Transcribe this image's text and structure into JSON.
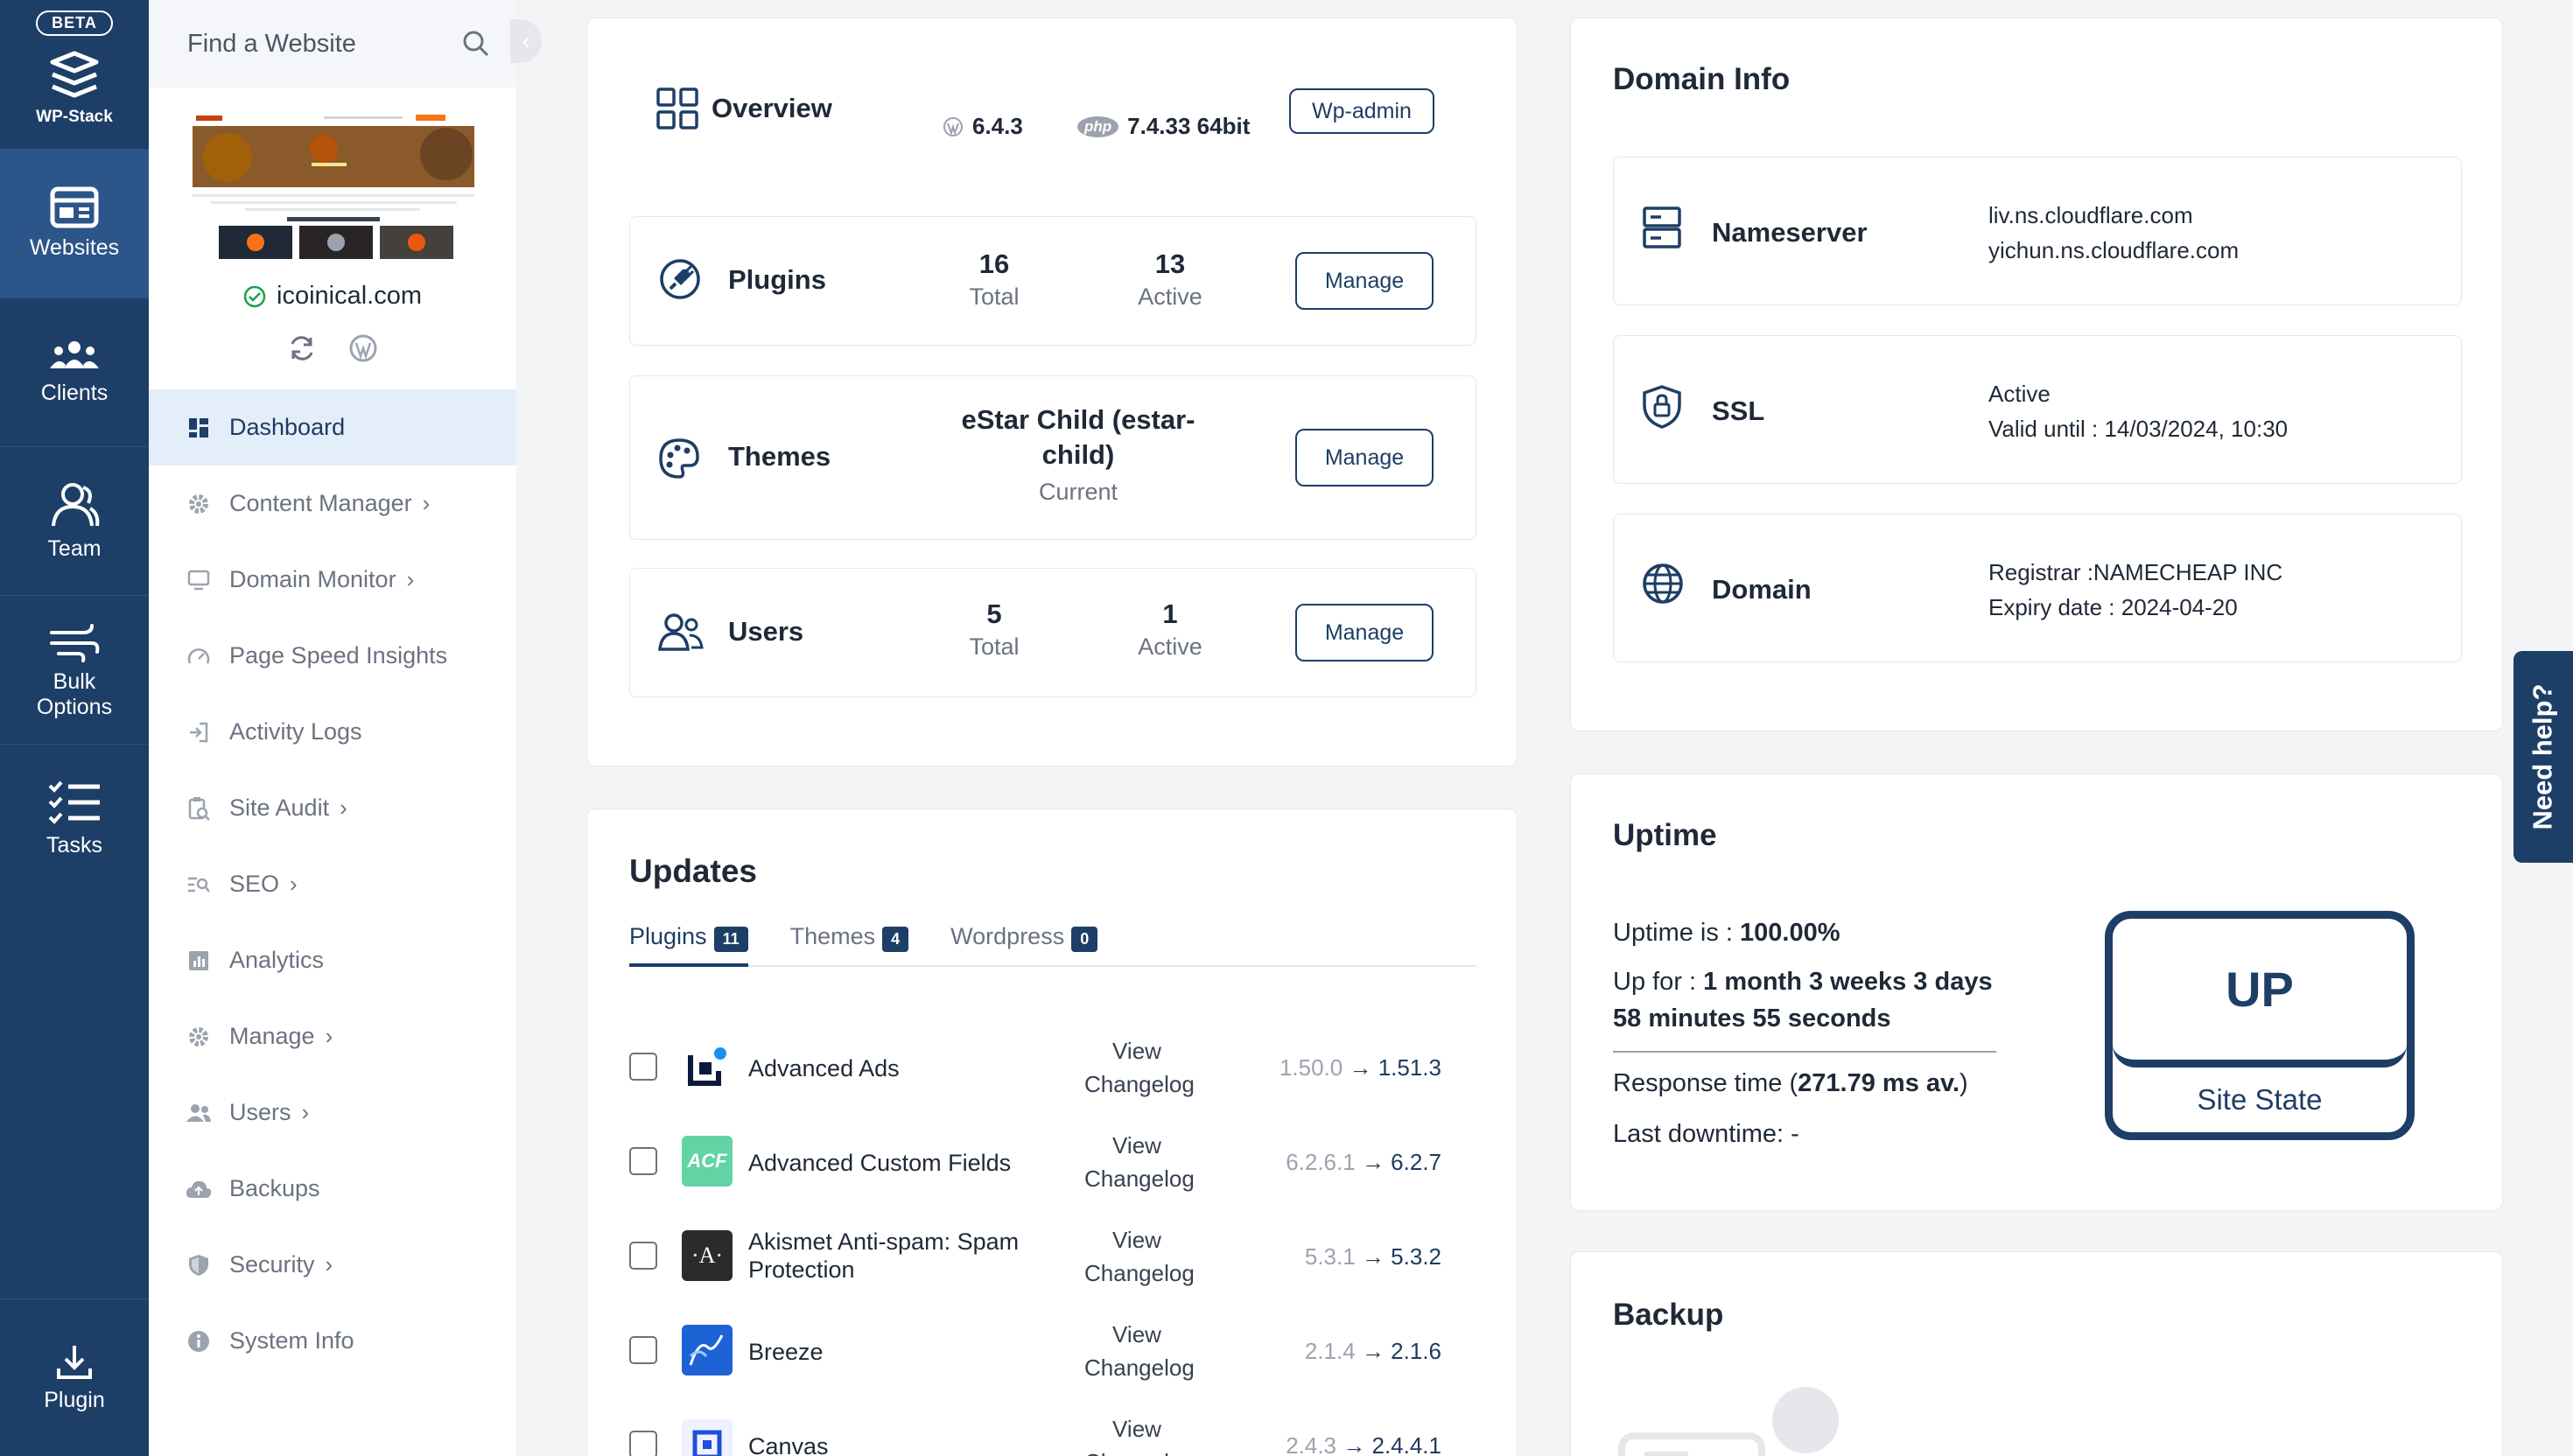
{
  "rail": {
    "beta": "BETA",
    "brand": "WP-Stack",
    "items": [
      {
        "label": "Websites",
        "icon": "websites-icon"
      },
      {
        "label": "Clients",
        "icon": "clients-icon"
      },
      {
        "label": "Team",
        "icon": "team-icon"
      },
      {
        "label": "Bulk Options",
        "icon": "bulk-options-icon"
      },
      {
        "label": "Tasks",
        "icon": "tasks-icon"
      }
    ],
    "plugin": "Plugin"
  },
  "sidebar": {
    "search_placeholder": "Find a Website",
    "site_name": "icoinical.com",
    "menu": [
      {
        "label": "Dashboard"
      },
      {
        "label": "Content Manager"
      },
      {
        "label": "Domain Monitor"
      },
      {
        "label": "Page Speed Insights"
      },
      {
        "label": "Activity Logs"
      },
      {
        "label": "Site Audit"
      },
      {
        "label": "SEO"
      },
      {
        "label": "Analytics"
      },
      {
        "label": "Manage"
      },
      {
        "label": "Users"
      },
      {
        "label": "Backups"
      },
      {
        "label": "Security"
      },
      {
        "label": "System Info"
      }
    ]
  },
  "overview": {
    "title": "Overview",
    "wp_version": "6.4.3",
    "php_badge": "php",
    "php_version": "7.4.33 64bit",
    "wp_admin": "Wp-admin",
    "plugins": {
      "label": "Plugins",
      "total": "16",
      "total_label": "Total",
      "active": "13",
      "active_label": "Active",
      "button": "Manage"
    },
    "themes": {
      "label": "Themes",
      "current": "eStar Child (estar-child)",
      "current_label": "Current",
      "button": "Manage"
    },
    "users": {
      "label": "Users",
      "total": "5",
      "total_label": "Total",
      "active": "1",
      "active_label": "Active",
      "button": "Manage"
    }
  },
  "updates": {
    "title": "Updates",
    "tabs": [
      {
        "label": "Plugins",
        "count": "11"
      },
      {
        "label": "Themes",
        "count": "4"
      },
      {
        "label": "Wordpress",
        "count": "0"
      }
    ],
    "changelog_line1": "View",
    "changelog_line2": "Changelog",
    "arrow": "→",
    "items": [
      {
        "name": "Advanced Ads",
        "from": "1.50.0",
        "to": "1.51.3"
      },
      {
        "name": "Advanced Custom Fields",
        "from": "6.2.6.1",
        "to": "6.2.7",
        "logo": "ACF"
      },
      {
        "name": "Akismet Anti-spam: Spam Protection",
        "from": "5.3.1",
        "to": "5.3.2",
        "logo": "·A·"
      },
      {
        "name": "Breeze",
        "from": "2.1.4",
        "to": "2.1.6"
      },
      {
        "name": "Canvas",
        "from": "2.4.3",
        "to": "2.4.4.1"
      }
    ]
  },
  "domain_info": {
    "title": "Domain Info",
    "nameserver": {
      "label": "Nameserver",
      "line1": "liv.ns.cloudflare.com",
      "line2": "yichun.ns.cloudflare.com"
    },
    "ssl": {
      "label": "SSL",
      "line1": "Active",
      "line2": "Valid until : 14/03/2024, 10:30"
    },
    "domain": {
      "label": "Domain",
      "line1": "Registrar :NAMECHEAP INC",
      "line2": "Expiry date : 2024-04-20"
    }
  },
  "uptime": {
    "title": "Uptime",
    "uptime_prefix": "Uptime is : ",
    "uptime_value": "100.00%",
    "upfor_prefix": "Up for : ",
    "upfor_value1": "1 month 3 weeks 3 days",
    "upfor_value2": "58 minutes 55 seconds",
    "response_prefix": "Response time (",
    "response_value": "271.79 ms av.",
    "response_suffix": ")",
    "last_downtime": "Last downtime: -",
    "state": "UP",
    "state_label": "Site State"
  },
  "backup": {
    "title": "Backup"
  },
  "help": "Need help?",
  "colors": {
    "primary": "#1d3e66",
    "rail": "#1d3e66",
    "active_menu_bg": "#e3eefa",
    "success": "#16a34a"
  }
}
